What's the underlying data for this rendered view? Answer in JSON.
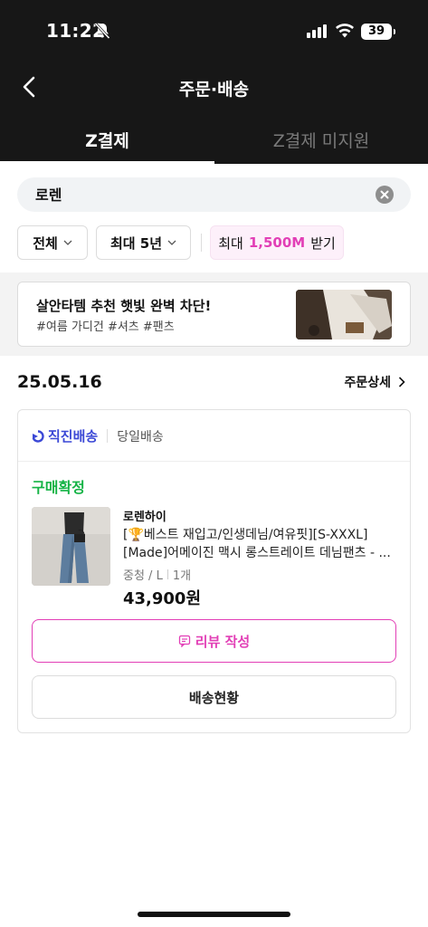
{
  "status_bar": {
    "time": "11:22",
    "battery": "39"
  },
  "header": {
    "title": "주문·배송"
  },
  "tabs": [
    {
      "label": "Z결제",
      "active": true
    },
    {
      "label": "Z결제 미지원",
      "active": false
    }
  ],
  "search": {
    "value": "로렌"
  },
  "filters": {
    "all": "전체",
    "period": "최대 5년",
    "reward_prefix": "최대",
    "reward_amount": "1,500M",
    "reward_suffix": "받기"
  },
  "banner": {
    "title": "살안타템 추천 햇빛 완벽 차단!",
    "subtitle": "#여름 가디건 #셔츠 #팬츠"
  },
  "order": {
    "date": "25.05.16",
    "detail_label": "주문상세",
    "shipping_type": "직진배송",
    "shipping_speed": "당일배송",
    "status": "구매확정",
    "brand": "로렌하이",
    "product_name": "[🏆베스트 재입고/인생데님/여유핏][S-XXXL][Made]어메이진 맥시 롱스트레이트 데님팬츠 - ...",
    "option": "중청 / L",
    "quantity": "1개",
    "price": "43,900원",
    "review_button": "리뷰 작성",
    "track_button": "배송현황"
  },
  "colors": {
    "header_bg": "#171717",
    "accent_pink": "#e23fb6",
    "status_green": "#14b345",
    "shipping_blue": "#3b48d6"
  }
}
